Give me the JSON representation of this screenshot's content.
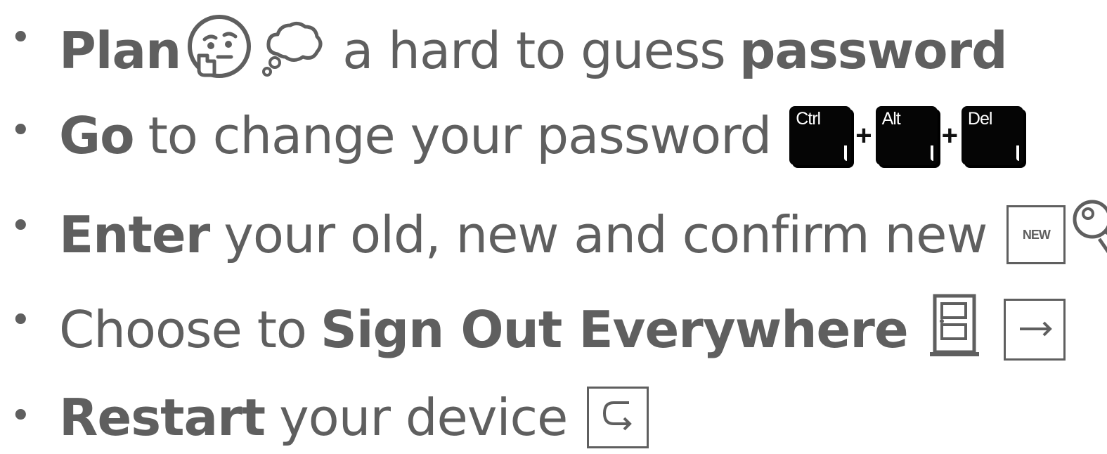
{
  "bullets": [
    {
      "marker": "•",
      "parts": [
        {
          "text": "Plan",
          "bold": true
        },
        {
          "text": "a hard to guess",
          "bold": false
        },
        {
          "text": "password",
          "bold": true
        }
      ]
    },
    {
      "marker": "•",
      "parts": [
        {
          "text": "Go",
          "bold": true
        },
        {
          "text": "to change your password",
          "bold": false
        }
      ],
      "keys": [
        "Ctrl",
        "Alt",
        "Del"
      ],
      "plus": "+"
    },
    {
      "marker": "•",
      "parts": [
        {
          "text": "Enter",
          "bold": true
        },
        {
          "text": "your old, new and confirm new",
          "bold": false
        }
      ],
      "new_label": "NEW"
    },
    {
      "marker": "•",
      "parts": [
        {
          "text": "Choose to",
          "bold": false
        },
        {
          "text": "Sign Out Everywhere",
          "bold": true
        }
      ]
    },
    {
      "marker": "•",
      "parts": [
        {
          "text": "Restart",
          "bold": true
        },
        {
          "text": "your device",
          "bold": false
        }
      ]
    }
  ],
  "icons": {
    "row1": [
      "thinking-face-icon",
      "thought-balloon-icon"
    ],
    "row2": [
      "ctrl-key-icon",
      "alt-key-icon",
      "del-key-icon"
    ],
    "row3": [
      "new-button-icon",
      "key-icon"
    ],
    "row4": [
      "door-icon",
      "right-arrow-icon"
    ],
    "row5": [
      "return-arrow-icon"
    ]
  },
  "colors": {
    "text": "#5f5f5f",
    "key_background": "#050505"
  }
}
